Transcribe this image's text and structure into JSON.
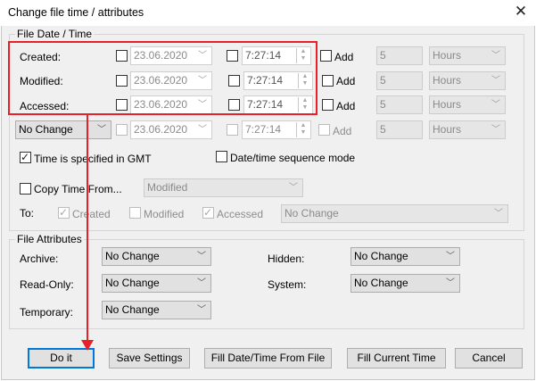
{
  "window": {
    "title": "Change file time / attributes",
    "close_icon": "close-icon"
  },
  "date_group": {
    "label": "File Date / Time"
  },
  "rows": [
    {
      "label": "Created:",
      "date": "23.06.2020",
      "time": "7:27:14",
      "add_label": "Add",
      "amount": "5",
      "unit": "Hours"
    },
    {
      "label": "Modified:",
      "date": "23.06.2020",
      "time": "7:27:14",
      "add_label": "Add",
      "amount": "5",
      "unit": "Hours"
    },
    {
      "label": "Accessed:",
      "date": "23.06.2020",
      "time": "7:27:14",
      "add_label": "Add",
      "amount": "5",
      "unit": "Hours"
    },
    {
      "label": "No Change",
      "date": "23.06.2020",
      "time": "7:27:14",
      "add_label": "Add",
      "amount": "5",
      "unit": "Hours"
    }
  ],
  "options": {
    "gmt_label": "Time is specified in GMT",
    "gmt_checked": true,
    "sequence_label": "Date/time sequence mode",
    "copy_label": "Copy Time From...",
    "copy_source": "Modified",
    "to_label": "To:",
    "to_created": "Created",
    "to_modified": "Modified",
    "to_accessed": "Accessed",
    "to_select": "No Change"
  },
  "attributes": {
    "label": "File Attributes",
    "archive_label": "Archive:",
    "archive_value": "No Change",
    "readonly_label": "Read-Only:",
    "readonly_value": "No Change",
    "temporary_label": "Temporary:",
    "temporary_value": "No Change",
    "hidden_label": "Hidden:",
    "hidden_value": "No Change",
    "system_label": "System:",
    "system_value": "No Change"
  },
  "buttons": {
    "doit": "Do it",
    "save_settings": "Save Settings",
    "fill_from_file": "Fill Date/Time From File",
    "fill_current": "Fill Current Time",
    "cancel": "Cancel"
  },
  "annotation_color": "#e8202a"
}
